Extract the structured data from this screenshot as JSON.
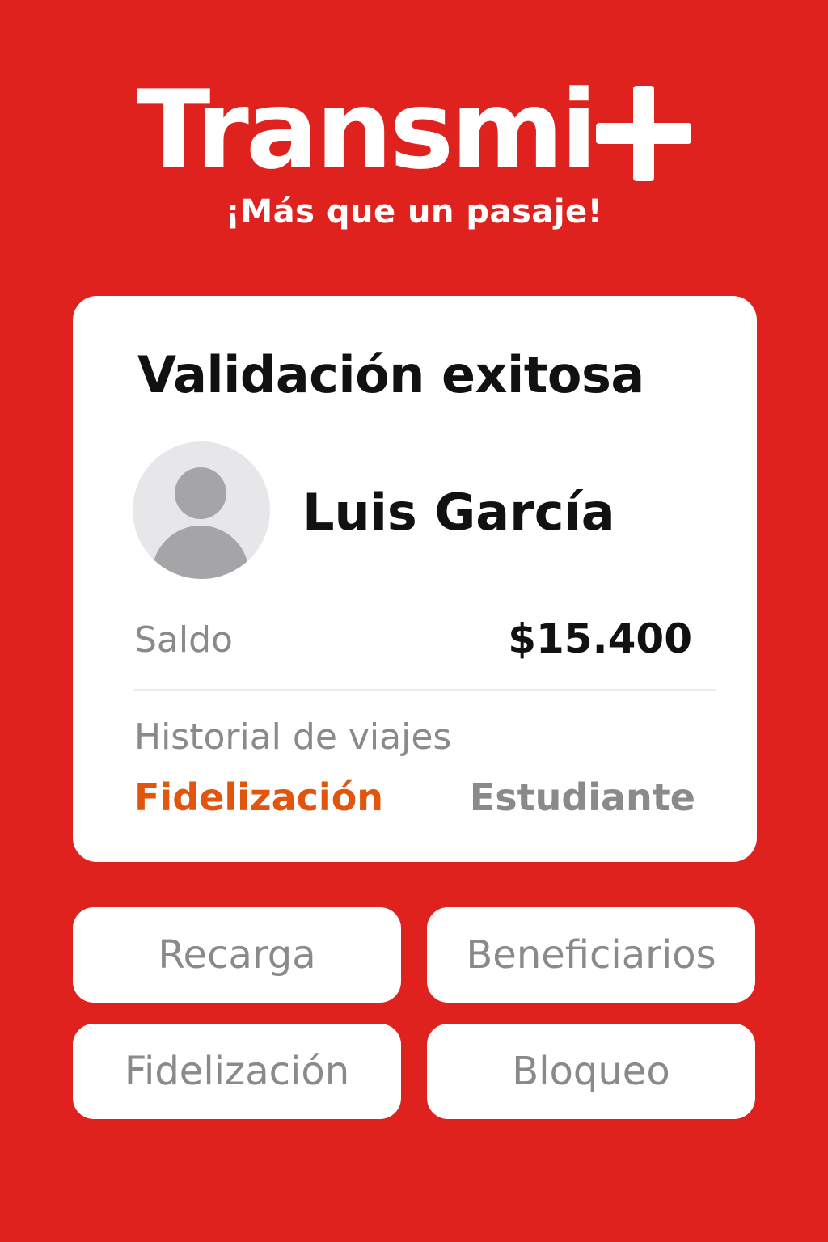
{
  "brand": {
    "name": "Transmi",
    "logo_icon": "plus-icon",
    "tagline": "¡Más que un pasaje!",
    "background_color": "#e0221e"
  },
  "card": {
    "title": "Validación exitosa",
    "user": {
      "avatar_icon": "user-avatar-icon",
      "name": "Luis García"
    },
    "balance": {
      "label": "Saldo",
      "value": "$15.400"
    },
    "history_label": "Historial de viajes",
    "tags": [
      {
        "label": "Fidelización",
        "color": "#e2550c"
      },
      {
        "label": "Estudiante",
        "color": "#8a8a8a"
      }
    ]
  },
  "actions": [
    {
      "label": "Recarga"
    },
    {
      "label": "Beneficiarios"
    },
    {
      "label": "Fidelización"
    },
    {
      "label": "Bloqueo"
    }
  ]
}
